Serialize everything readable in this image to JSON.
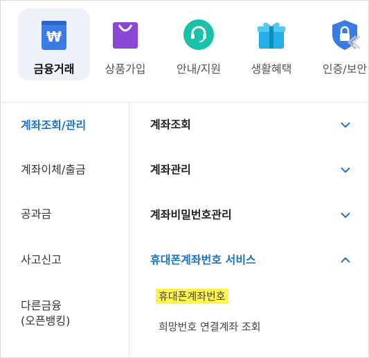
{
  "categories": [
    {
      "label": "금융거래",
      "icon": "won-wallet-icon",
      "active": true
    },
    {
      "label": "상품가입",
      "icon": "shopping-bag-icon",
      "active": false
    },
    {
      "label": "안내/지원",
      "icon": "headset-icon",
      "active": false
    },
    {
      "label": "생활혜택",
      "icon": "gift-box-icon",
      "active": false
    },
    {
      "label": "인증/보안",
      "icon": "shield-lock-icon",
      "active": false
    }
  ],
  "left_menu": [
    {
      "label": "계좌조회/관리",
      "active": true
    },
    {
      "label": "계좌이체/출금",
      "active": false
    },
    {
      "label": "공과금",
      "active": false
    },
    {
      "label": "사고신고",
      "active": false
    },
    {
      "label": "다른금융\n(오픈뱅킹)",
      "active": false
    }
  ],
  "right_menu": [
    {
      "label": "계좌조회",
      "expanded": false
    },
    {
      "label": "계좌관리",
      "expanded": false
    },
    {
      "label": "계좌비밀번호관리",
      "expanded": false
    },
    {
      "label": "휴대폰계좌번호 서비스",
      "expanded": true
    }
  ],
  "submenu": [
    {
      "label": "휴대폰계좌번호",
      "highlighted": true
    },
    {
      "label": "희망번호 연결계좌 조회",
      "highlighted": false
    }
  ],
  "colors": {
    "accent": "#1a73c8",
    "highlight": "#fff34f",
    "active_tile": "#eef1f7"
  }
}
